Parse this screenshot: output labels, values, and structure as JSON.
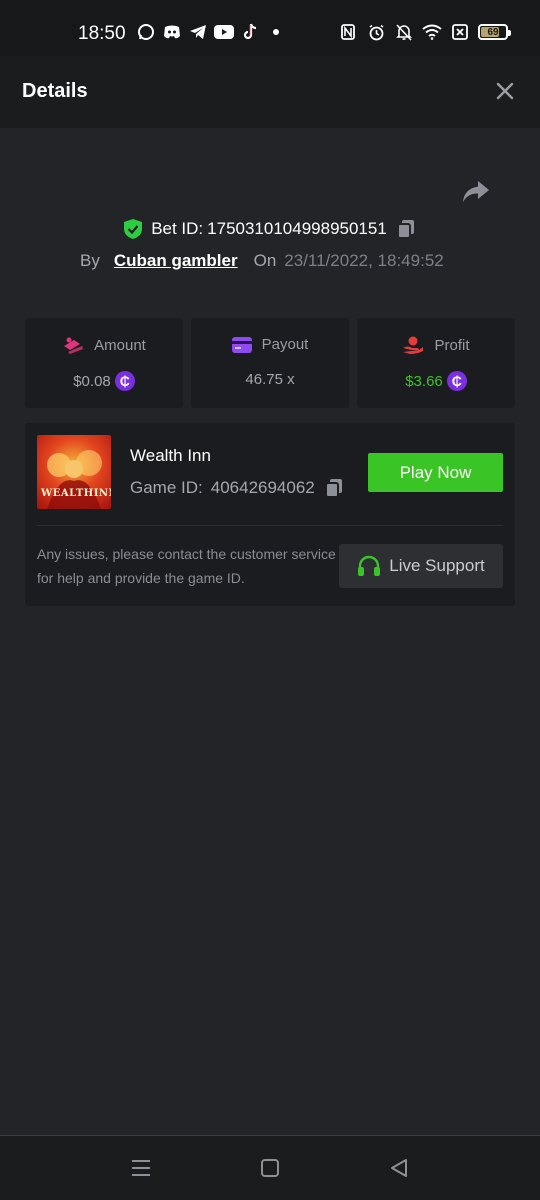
{
  "status_bar": {
    "time": "18:50",
    "battery": "69",
    "icons_left": [
      "whatsapp-icon",
      "discord-icon",
      "telegram-icon",
      "youtube-icon",
      "tiktok-icon",
      "dot-icon"
    ],
    "icons_right": [
      "nfc-icon",
      "alarm-icon",
      "bell-off-icon",
      "wifi-icon",
      "sim-x-icon",
      "battery-icon"
    ]
  },
  "header": {
    "title": "Details"
  },
  "bet": {
    "label": "Bet ID:",
    "id": "1750310104998950151",
    "by_label": "By",
    "username": "Cuban gambler",
    "on_label": "On",
    "date": "23/11/2022, 18:49:52"
  },
  "stats": {
    "amount": {
      "label": "Amount",
      "value": "$0.08",
      "icon": "amount-icon"
    },
    "payout": {
      "label": "Payout",
      "value": "46.75 x",
      "icon": "card-icon"
    },
    "profit": {
      "label": "Profit",
      "value": "$3.66",
      "icon": "profit-icon"
    }
  },
  "coin_symbol": "₵",
  "game": {
    "thumb_text": "WEALTHINN",
    "name": "Wealth Inn",
    "id_label": "Game ID:",
    "id": "40642694062",
    "play_label": "Play Now",
    "issues_text": "Any issues, please contact the customer service for help and provide the game ID.",
    "support_label": "Live Support"
  },
  "colors": {
    "accent_green": "#3bc425",
    "coin_purple": "#7b2fe0",
    "shield_green": "#2ecc40",
    "amount_pink": "#e0357a",
    "card_purple": "#8e4cf0",
    "profit_red": "#e63b3b"
  }
}
